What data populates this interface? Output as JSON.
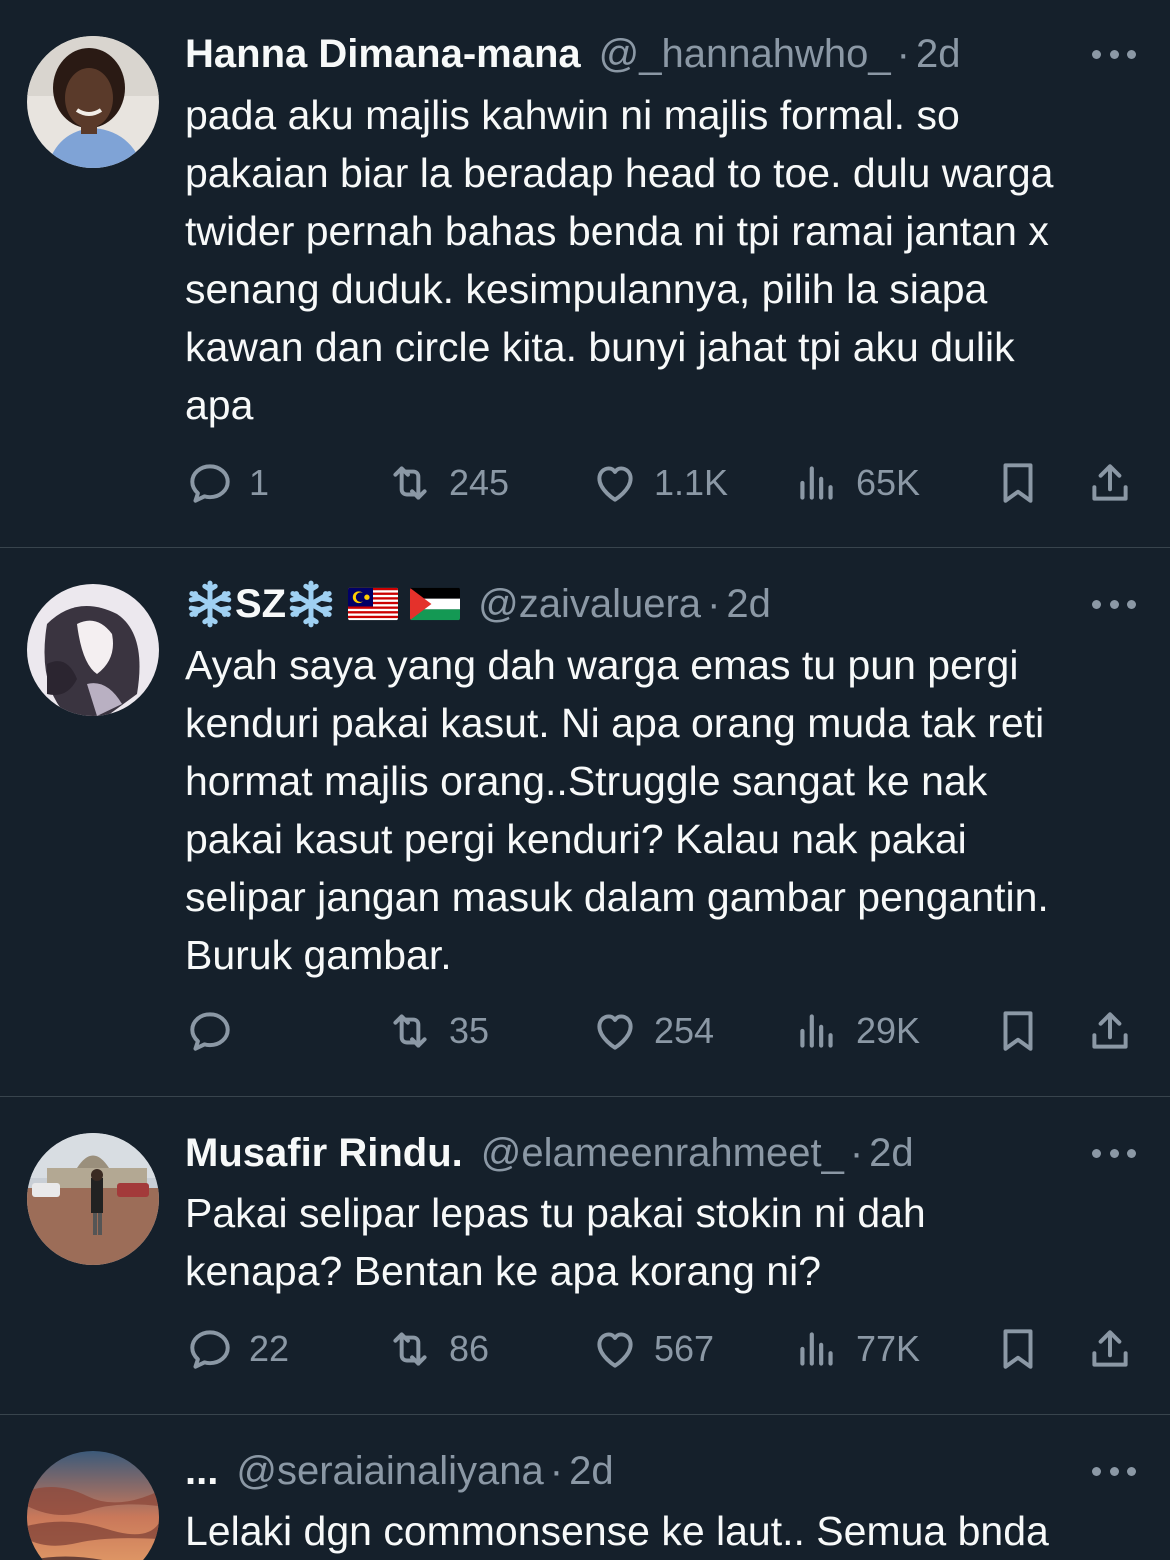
{
  "tweets": [
    {
      "name": "Hanna Dimana-mana",
      "handle": "@_hannahwho_",
      "dot": "·",
      "time": "2d",
      "body": "pada aku majlis kahwin ni majlis formal. so\npakaian biar la beradap head to toe. dulu warga\ntwider pernah bahas benda ni tpi ramai jantan x\nsenang duduk. kesimpulannya, pilih la siapa\nkawan dan circle kita. bunyi jahat tpi aku dulik\napa",
      "replies": "1",
      "retweets": "245",
      "likes": "1.1K",
      "views": "65K"
    },
    {
      "name": "SZ",
      "name_emoji": "snowflake",
      "flags": [
        "malaysia-flag",
        "palestine-flag"
      ],
      "handle": "@zaivaluera",
      "dot": "·",
      "time": "2d",
      "body": "Ayah saya yang dah warga emas tu pun pergi\nkenduri pakai kasut. Ni apa orang muda tak reti\nhormat majlis orang..Struggle sangat ke nak\npakai kasut pergi kenduri? Kalau nak pakai\nselipar jangan masuk dalam gambar pengantin.\nBuruk gambar.",
      "replies": "",
      "retweets": "35",
      "likes": "254",
      "views": "29K"
    },
    {
      "name": "Musafir Rindu.",
      "handle": "@elameenrahmeet_",
      "dot": "·",
      "time": "2d",
      "body": "Pakai selipar lepas tu pakai stokin ni dah\nkenapa? Bentan ke apa korang ni?",
      "replies": "22",
      "retweets": "86",
      "likes": "567",
      "views": "77K"
    },
    {
      "name": "...",
      "handle": "@seraiainaliyana",
      "dot": "·",
      "time": "2d",
      "body": "Lelaki dgn commonsense ke laut.. Semua bnda"
    }
  ],
  "icons": {
    "reply": "reply-icon",
    "retweet": "retweet-icon",
    "like": "heart-icon",
    "views": "views-icon",
    "bookmark": "bookmark-icon",
    "share": "share-icon",
    "more": "more-icon"
  },
  "colors": {
    "background": "#15202b",
    "text": "#f7f9f9",
    "secondary": "#8b98a5",
    "divider": "#38444d"
  }
}
